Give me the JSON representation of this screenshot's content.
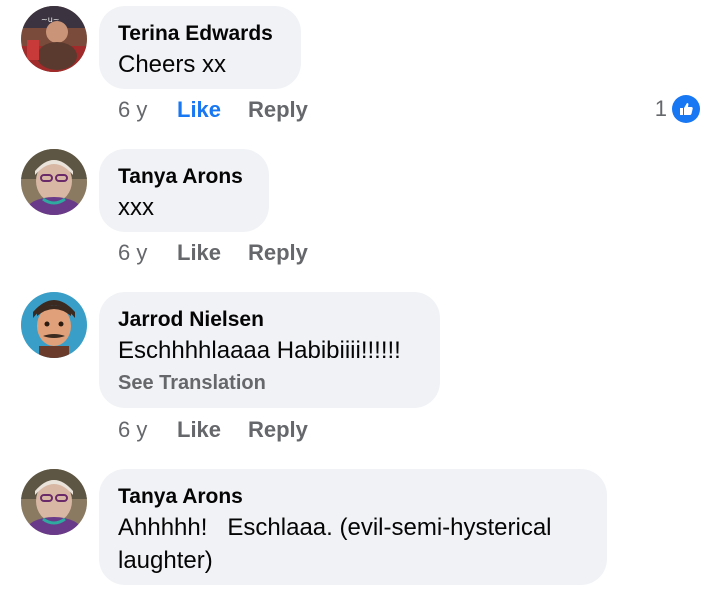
{
  "comments": [
    {
      "author": "Terina Edwards",
      "text": "Cheers xx",
      "time": "6 y",
      "like_label": "Like",
      "reply_label": "Reply",
      "liked": true,
      "reaction_count": "1"
    },
    {
      "author": "Tanya Arons",
      "text": "xxx",
      "time": "6 y",
      "like_label": "Like",
      "reply_label": "Reply"
    },
    {
      "author": "Jarrod Nielsen",
      "text": "Eschhhhlaaaa Habibiiii!!!!!!",
      "see_translation": "See Translation",
      "time": "6 y",
      "like_label": "Like",
      "reply_label": "Reply"
    },
    {
      "author": "Tanya Arons",
      "text": "Ahhhhh!   Eschlaaa. (evil-semi-hysterical laughter)"
    }
  ],
  "colors": {
    "bubble": "#f0f2f5",
    "like_active": "#1877f2",
    "secondary_text": "#65676b"
  },
  "icons": {
    "reaction": "thumbs-up-icon"
  }
}
